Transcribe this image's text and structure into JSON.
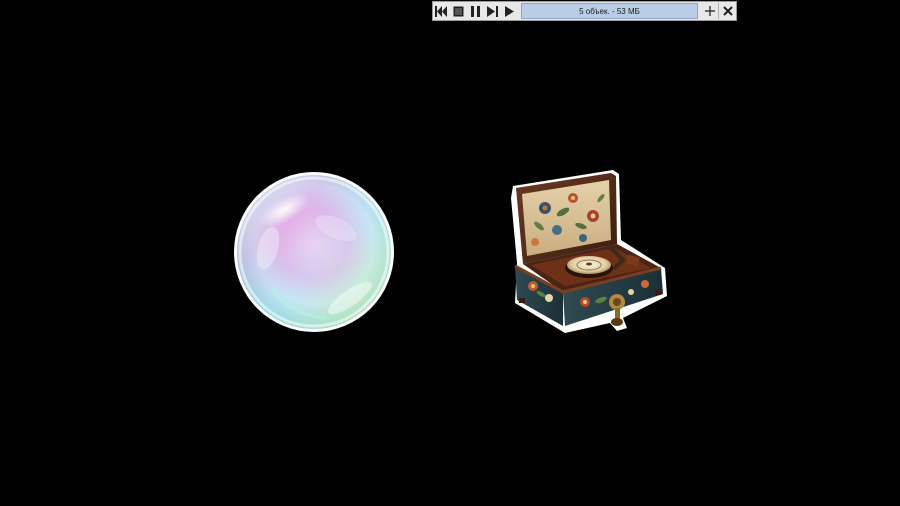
{
  "player": {
    "status_text": "5 объек. - 53 МБ",
    "controls": [
      {
        "name": "previous",
        "icon": "skip-back-icon"
      },
      {
        "name": "stop",
        "icon": "stop-icon"
      },
      {
        "name": "pause",
        "icon": "pause-icon"
      },
      {
        "name": "next",
        "icon": "skip-forward-icon"
      },
      {
        "name": "play",
        "icon": "play-icon"
      }
    ],
    "right_controls": [
      {
        "name": "add",
        "icon": "plus-icon"
      },
      {
        "name": "close",
        "icon": "close-icon"
      }
    ]
  },
  "objects": [
    {
      "name": "soap-bubble"
    },
    {
      "name": "vintage-music-box"
    }
  ],
  "colors": {
    "background": "#000000",
    "display": "#b9cde6",
    "toolbar": "#e8e8e8"
  }
}
